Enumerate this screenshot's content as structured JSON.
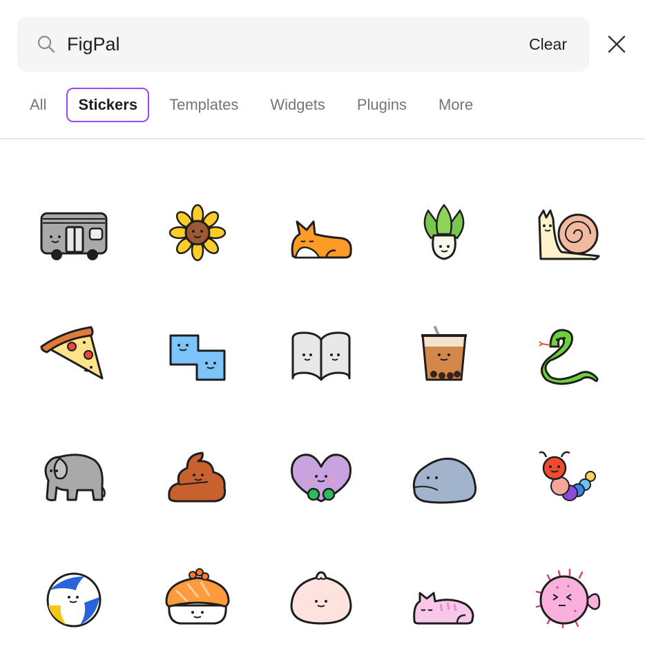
{
  "search": {
    "value": "FigPal",
    "clear_label": "Clear"
  },
  "tabs": [
    {
      "label": "All",
      "active": false
    },
    {
      "label": "Stickers",
      "active": true
    },
    {
      "label": "Templates",
      "active": false
    },
    {
      "label": "Widgets",
      "active": false
    },
    {
      "label": "Plugins",
      "active": false
    },
    {
      "label": "More",
      "active": false
    }
  ],
  "colors": {
    "accent": "#9747ff",
    "search_bg": "#f5f5f5",
    "tab_text": "#757575"
  },
  "stickers": [
    "train",
    "sunflower",
    "corgi",
    "bok-choy",
    "snail",
    "pizza",
    "tetris-block",
    "book",
    "bubble-tea",
    "snake",
    "elephant",
    "poop",
    "heart",
    "blob",
    "caterpillar",
    "volleyball",
    "sushi",
    "dumpling",
    "cat",
    "pufferfish"
  ]
}
